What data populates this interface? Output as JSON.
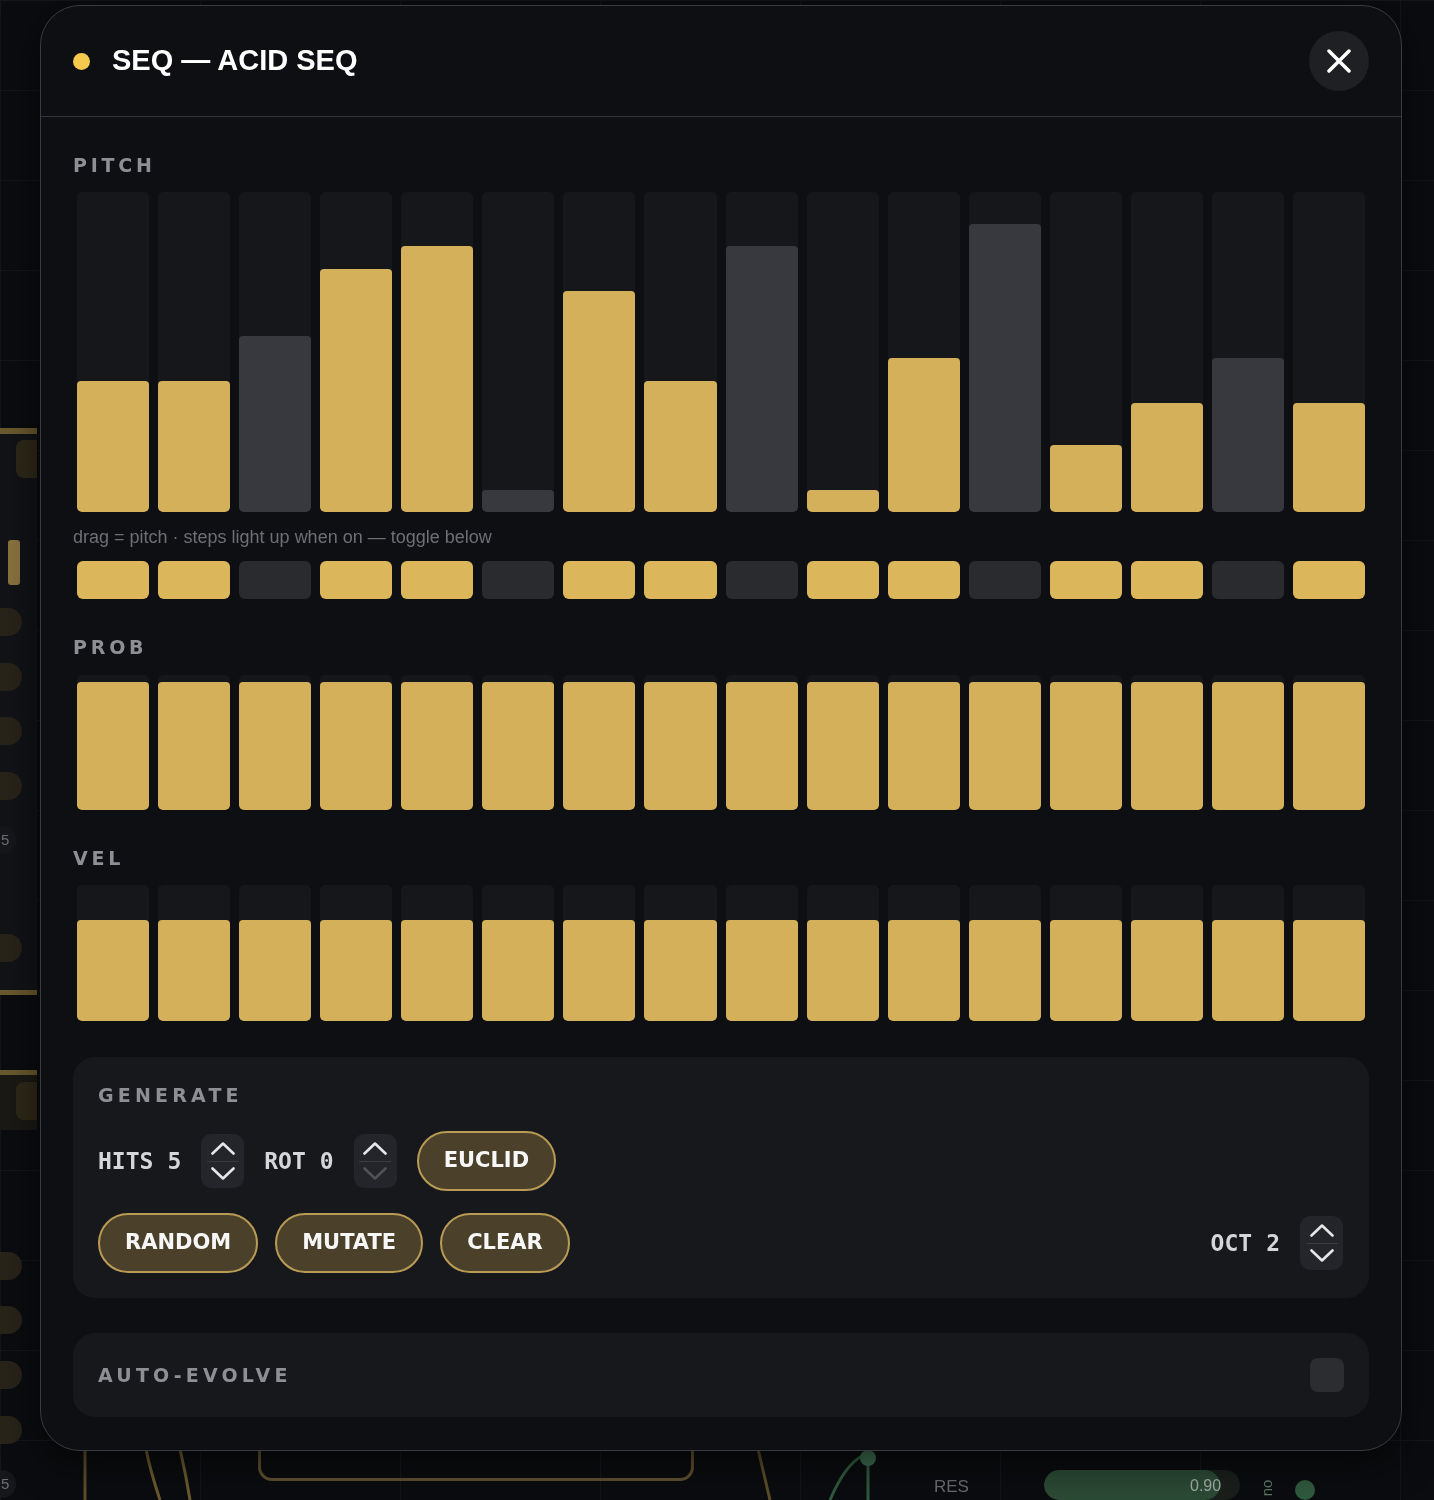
{
  "canvas": {
    "badges": [
      "5",
      "5"
    ],
    "res": {
      "label": "RES",
      "value": "0.90",
      "level": 0.9
    },
    "side_label": "no"
  },
  "dialog": {
    "title": "SEQ — ACID SEQ"
  },
  "pitch": {
    "label": "PITCH",
    "hint": "drag = pitch · steps light up when on — toggle below",
    "steps": [
      {
        "level": 0.41,
        "on": true
      },
      {
        "level": 0.41,
        "on": true
      },
      {
        "level": 0.55,
        "on": false
      },
      {
        "level": 0.76,
        "on": true
      },
      {
        "level": 0.83,
        "on": true
      },
      {
        "level": 0.07,
        "on": false
      },
      {
        "level": 0.69,
        "on": true
      },
      {
        "level": 0.41,
        "on": true
      },
      {
        "level": 0.83,
        "on": false
      },
      {
        "level": 0.07,
        "on": true
      },
      {
        "level": 0.48,
        "on": true
      },
      {
        "level": 0.9,
        "on": false
      },
      {
        "level": 0.21,
        "on": true
      },
      {
        "level": 0.34,
        "on": true
      },
      {
        "level": 0.48,
        "on": false
      },
      {
        "level": 0.34,
        "on": true
      }
    ]
  },
  "prob": {
    "label": "PROB",
    "steps": [
      {
        "level": 0.95
      },
      {
        "level": 0.95
      },
      {
        "level": 0.95
      },
      {
        "level": 0.95
      },
      {
        "level": 0.95
      },
      {
        "level": 0.95
      },
      {
        "level": 0.95
      },
      {
        "level": 0.95
      },
      {
        "level": 0.95
      },
      {
        "level": 0.95
      },
      {
        "level": 0.95
      },
      {
        "level": 0.95
      },
      {
        "level": 0.95
      },
      {
        "level": 0.95
      },
      {
        "level": 0.95
      },
      {
        "level": 0.95
      }
    ]
  },
  "vel": {
    "label": "VEL",
    "steps": [
      {
        "level": 0.74
      },
      {
        "level": 0.74
      },
      {
        "level": 0.74
      },
      {
        "level": 0.74
      },
      {
        "level": 0.74
      },
      {
        "level": 0.74
      },
      {
        "level": 0.74
      },
      {
        "level": 0.74
      },
      {
        "level": 0.74
      },
      {
        "level": 0.74
      },
      {
        "level": 0.74
      },
      {
        "level": 0.74
      },
      {
        "level": 0.74
      },
      {
        "level": 0.74
      },
      {
        "level": 0.74
      },
      {
        "level": 0.74
      }
    ]
  },
  "generate": {
    "label": "GENERATE",
    "hits": {
      "label": "HITS",
      "value": "5",
      "down_disabled": false
    },
    "rot": {
      "label": "ROT",
      "value": "0",
      "down_disabled": true
    },
    "euclid": "EUCLID",
    "buttons": [
      "RANDOM",
      "MUTATE",
      "CLEAR"
    ],
    "oct": {
      "label": "OCT",
      "value": "2",
      "down_disabled": false
    }
  },
  "auto_evolve": {
    "label": "AUTO-EVOLVE",
    "on": false
  }
}
